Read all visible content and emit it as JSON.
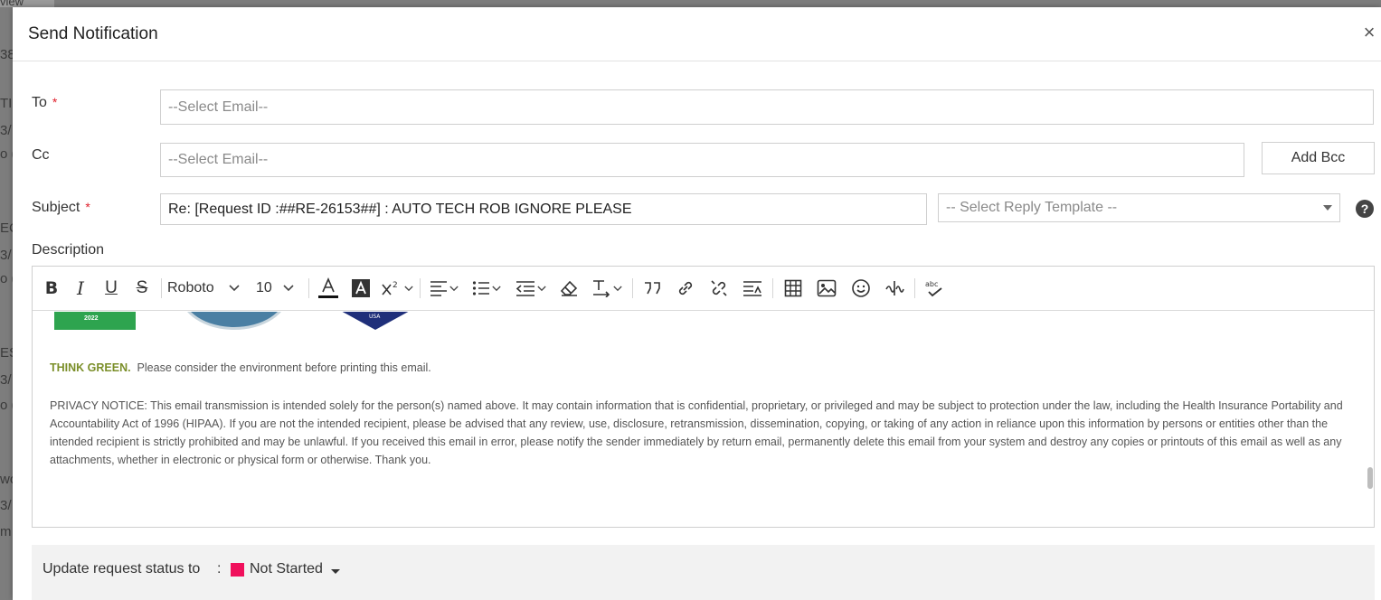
{
  "background": {
    "fragments": [
      "view",
      "38",
      "TI",
      "3/",
      "o (",
      "EC",
      "3/",
      "o (",
      "ES",
      "3/",
      "o (",
      "wo",
      "3/",
      "m"
    ]
  },
  "modal": {
    "title": "Send Notification",
    "close_label": "×"
  },
  "form": {
    "to": {
      "label": "To",
      "required_mark": "*",
      "placeholder": "--Select Email--"
    },
    "cc": {
      "label": "Cc",
      "placeholder": "--Select Email--"
    },
    "add_bcc_label": "Add Bcc",
    "subject": {
      "label": "Subject",
      "required_mark": "*",
      "value": "Re: [Request ID :##RE-26153##] : AUTO TECH ROB IGNORE PLEASE"
    },
    "reply_template": {
      "placeholder": "-- Select Reply Template --"
    },
    "help_label": "?",
    "description_label": "Description"
  },
  "toolbar": {
    "bold": "B",
    "italic": "I",
    "underline": "U",
    "strikethrough": "S",
    "font_family": "Roboto",
    "font_size": "10"
  },
  "editor": {
    "logo_year": "2022",
    "logo_shield_text": "USA",
    "think_green_strong": "THINK GREEN.",
    "think_green_rest": "Please consider the environment before printing this email.",
    "privacy_notice": "PRIVACY NOTICE: This email transmission is intended solely for the person(s) named above.  It may contain information that is confidential, proprietary, or privileged and may be subject to protection under the law, including the Health Insurance Portability and Accountability Act of 1996 (HIPAA). If you are not the intended recipient, please be advised that any review, use, disclosure, retransmission, dissemination, copying, or taking of any action in reliance upon this information by persons or entities other than the intended recipient is strictly prohibited and may be unlawful. If you received this email in error, please notify the sender immediately by return email, permanently delete this email from your system and destroy any copies or printouts of this email as well as any attachments, whether in electronic or physical form or otherwise. Thank you."
  },
  "footer": {
    "status_label": "Update request status to",
    "colon": ":",
    "status_value": "Not Started",
    "status_color": "#f0105c"
  }
}
